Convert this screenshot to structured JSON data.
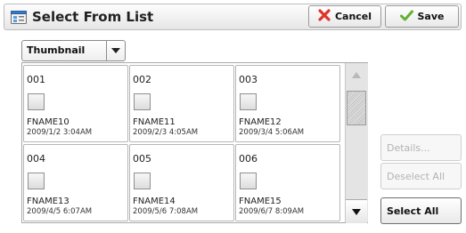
{
  "header": {
    "title": "Select From List",
    "title_icon": "list-window-icon",
    "cancel_label": "Cancel",
    "cancel_icon": "cancel-x-icon",
    "save_label": "Save",
    "save_icon": "checkmark-icon"
  },
  "view_select": {
    "value": "Thumbnail",
    "icon": "chevron-down-icon"
  },
  "tiles": [
    {
      "num": "001",
      "name": "FNAME10",
      "date": "2009/1/2 3:04AM"
    },
    {
      "num": "002",
      "name": "FNAME11",
      "date": "2009/2/3 4:05AM"
    },
    {
      "num": "003",
      "name": "FNAME12",
      "date": "2009/3/4 5:06AM"
    },
    {
      "num": "004",
      "name": "FNAME13",
      "date": "2009/4/5 6:07AM"
    },
    {
      "num": "005",
      "name": "FNAME14",
      "date": "2009/5/6 7:08AM"
    },
    {
      "num": "006",
      "name": "FNAME15",
      "date": "2009/6/7 8:09AM"
    }
  ],
  "scrollbar": {
    "up_icon": "scroll-up-arrow-icon",
    "down_icon": "scroll-down-arrow-icon"
  },
  "side_buttons": {
    "details": "Details...",
    "deselect_all": "Deselect All",
    "select_all": "Select All"
  },
  "colors": {
    "cancel_x": "#e0342a",
    "save_check": "#62b030",
    "icon_blue": "#3a78c4"
  }
}
